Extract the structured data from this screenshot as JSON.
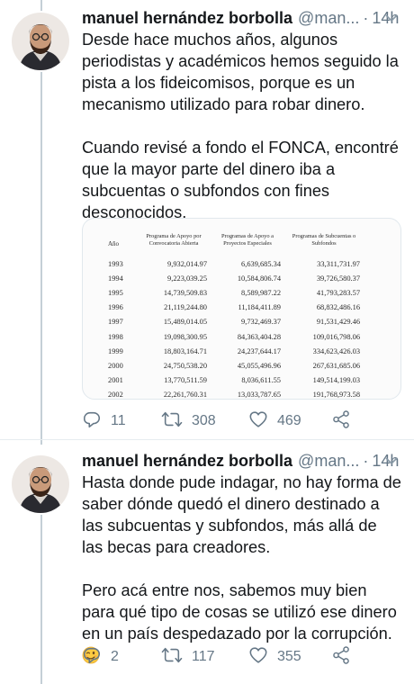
{
  "tweets": [
    {
      "author_name": "manuel hernández borbolla",
      "handle": "@man...",
      "separator": "·",
      "time": "14h",
      "paragraphs": [
        "Desde hace muchos años, algunos periodistas y académicos hemos seguido la pista a los fideicomisos, porque es un mecanismo utilizado para robar dinero.",
        "Cuando revisé a fondo el FONCA, encontré que la mayor parte del dinero iba a subcuentas o subfondos con fines desconocidos."
      ],
      "media_table": {
        "headers": [
          "Año",
          "Programa de Apoyo por Convocatoria Abierta",
          "Programas de Apoyo a Proyectos Especiales",
          "Programas de Subcuentas o Subfondos"
        ],
        "rows": [
          [
            "1993",
            "9,932,014.97",
            "6,639,685.34",
            "33,311,731.97"
          ],
          [
            "1994",
            "9,223,039.25",
            "10,584,806.74",
            "39,726,580.37"
          ],
          [
            "1995",
            "14,739,509.83",
            "8,589,987.22",
            "41,793,283.57"
          ],
          [
            "1996",
            "21,119,244.80",
            "11,184,411.89",
            "68,832,486.16"
          ],
          [
            "1997",
            "15,489,014.05",
            "9,732,469.37",
            "91,531,429.46"
          ],
          [
            "1998",
            "19,098,300.95",
            "84,363,404.28",
            "109,016,798.06"
          ],
          [
            "1999",
            "18,803,164.71",
            "24,237,644.17",
            "334,623,426.03"
          ],
          [
            "2000",
            "24,750,538.20",
            "45,055,496.96",
            "267,631,685.06"
          ],
          [
            "2001",
            "13,770,511.59",
            "8,036,611.55",
            "149,514,199.03"
          ],
          [
            "2002",
            "22,261,760.31",
            "13,033,787.65",
            "191,768,973.58"
          ]
        ]
      },
      "actions": {
        "replies": "11",
        "retweets": "308",
        "likes": "469"
      }
    },
    {
      "author_name": "manuel hernández borbolla",
      "handle": "@man...",
      "separator": "·",
      "time": "14h",
      "paragraphs": [
        "Hasta donde pude indagar, no hay forma de saber dónde quedó el dinero destinado a las subcuentas y subfondos, más allá de las becas para creadores.",
        "Pero acá entre nos, sabemos muy bien para qué tipo de cosas se utilizó ese dinero en un país despedazado por la corrupción."
      ],
      "emoji": "winking-face",
      "actions": {
        "replies": "2",
        "retweets": "117",
        "likes": "355"
      }
    }
  ],
  "colors": {
    "text": "#14171a",
    "secondary": "#657786",
    "thread_line": "#c4cfd6",
    "divider": "#e6ecf0"
  }
}
